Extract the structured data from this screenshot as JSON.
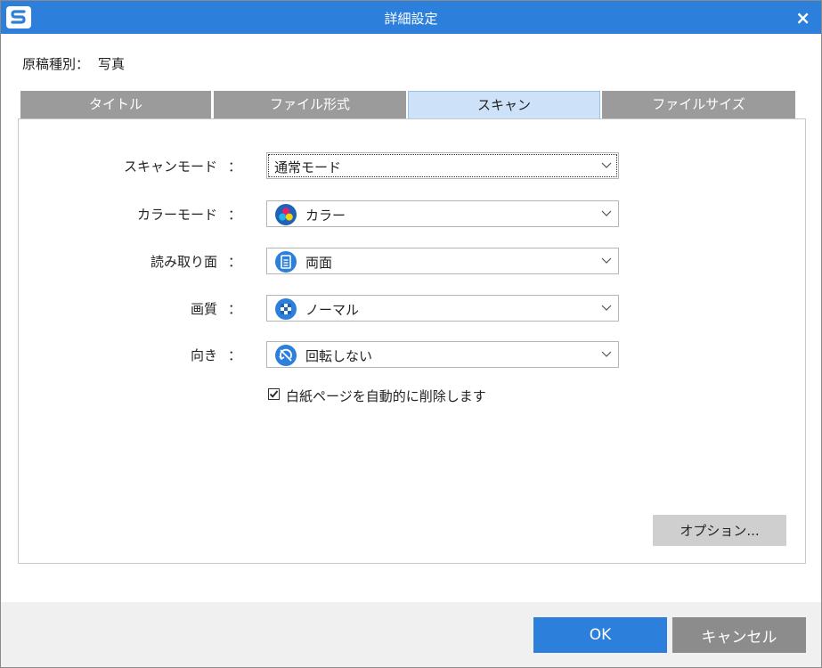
{
  "window": {
    "title": "詳細設定",
    "close_glyph": "×"
  },
  "doctype": {
    "label": "原稿種別：",
    "value": "写真"
  },
  "tabs": [
    {
      "label": "タイトル",
      "active": false
    },
    {
      "label": "ファイル形式",
      "active": false
    },
    {
      "label": "スキャン",
      "active": true
    },
    {
      "label": "ファイルサイズ",
      "active": false
    }
  ],
  "settings": {
    "colon": "：",
    "scan_mode": {
      "label": "スキャンモード",
      "value": "通常モード"
    },
    "color_mode": {
      "label": "カラーモード",
      "value": "カラー",
      "icon": "color-circles-icon"
    },
    "scan_side": {
      "label": "読み取り面",
      "value": "両面",
      "icon": "duplex-page-icon"
    },
    "quality": {
      "label": "画質",
      "value": "ノーマル",
      "icon": "checker-quality-icon"
    },
    "orientation": {
      "label": "向き",
      "value": "回転しない",
      "icon": "no-rotate-icon"
    },
    "blank_page": {
      "label": "白紙ページを自動的に削除します",
      "checked": true
    }
  },
  "buttons": {
    "options": "オプション...",
    "ok": "OK",
    "cancel": "キャンセル"
  },
  "colors": {
    "accent": "#2d7fdc",
    "tab_inactive": "#9b9b9b",
    "tab_active": "#cde2f8",
    "cancel": "#8c8c8c"
  }
}
